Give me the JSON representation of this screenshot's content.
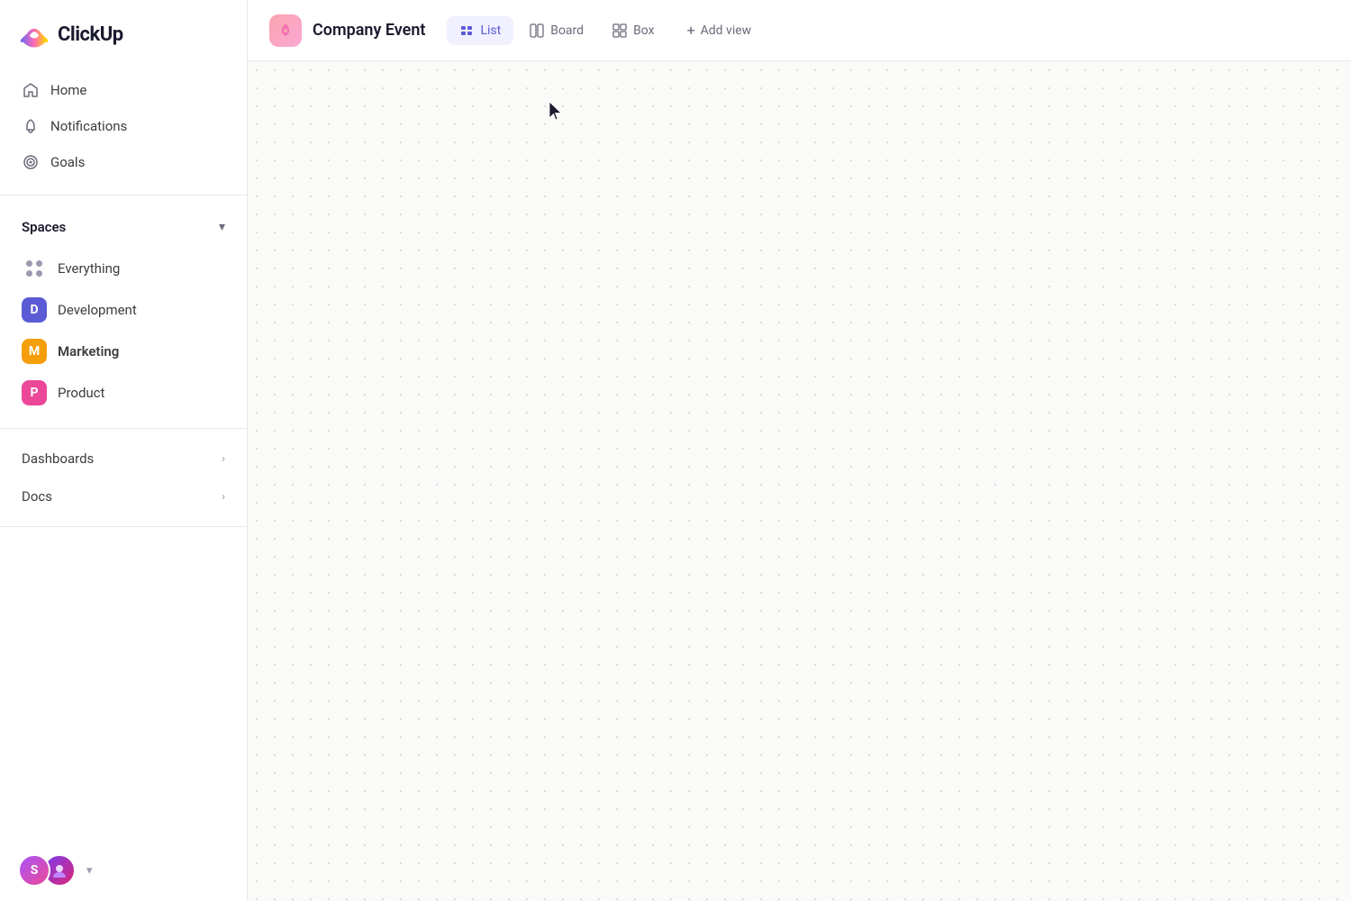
{
  "app": {
    "name": "ClickUp"
  },
  "sidebar": {
    "nav_items": [
      {
        "id": "home",
        "label": "Home"
      },
      {
        "id": "notifications",
        "label": "Notifications"
      },
      {
        "id": "goals",
        "label": "Goals"
      }
    ],
    "spaces_section": {
      "title": "Spaces",
      "items": [
        {
          "id": "everything",
          "label": "Everything",
          "type": "dots"
        },
        {
          "id": "development",
          "label": "Development",
          "type": "badge",
          "color": "blue",
          "letter": "D"
        },
        {
          "id": "marketing",
          "label": "Marketing",
          "type": "badge",
          "color": "yellow",
          "letter": "M",
          "bold": true
        },
        {
          "id": "product",
          "label": "Product",
          "type": "badge",
          "color": "pink",
          "letter": "P"
        }
      ]
    },
    "bottom_items": [
      {
        "id": "dashboards",
        "label": "Dashboards"
      },
      {
        "id": "docs",
        "label": "Docs"
      }
    ],
    "footer": {
      "avatar_initial": "S"
    }
  },
  "header": {
    "project_title": "Company Event",
    "views": [
      {
        "id": "list",
        "label": "List",
        "active": true
      },
      {
        "id": "board",
        "label": "Board",
        "active": false
      },
      {
        "id": "box",
        "label": "Box",
        "active": false
      }
    ],
    "add_view_label": "Add view"
  }
}
